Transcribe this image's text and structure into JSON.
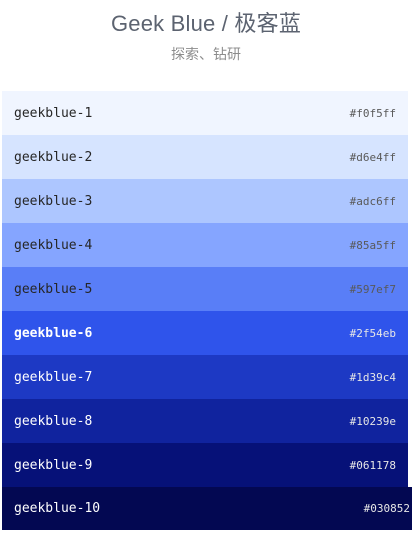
{
  "header": {
    "title": "Geek Blue / 极客蓝",
    "subtitle": "探索、钻研"
  },
  "palette": [
    {
      "name": "geekblue-1",
      "hex": "#f0f5ff",
      "color": "#f0f5ff",
      "text": "light"
    },
    {
      "name": "geekblue-2",
      "hex": "#d6e4ff",
      "color": "#d6e4ff",
      "text": "light"
    },
    {
      "name": "geekblue-3",
      "hex": "#adc6ff",
      "color": "#adc6ff",
      "text": "light"
    },
    {
      "name": "geekblue-4",
      "hex": "#85a5ff",
      "color": "#85a5ff",
      "text": "light"
    },
    {
      "name": "geekblue-5",
      "hex": "#597ef7",
      "color": "#597ef7",
      "text": "light"
    },
    {
      "name": "geekblue-6",
      "hex": "#2f54eb",
      "color": "#2f54eb",
      "text": "dark",
      "primary": true
    },
    {
      "name": "geekblue-7",
      "hex": "#1d39c4",
      "color": "#1d39c4",
      "text": "dark"
    },
    {
      "name": "geekblue-8",
      "hex": "#10239e",
      "color": "#10239e",
      "text": "dark"
    },
    {
      "name": "geekblue-9",
      "hex": "#061178",
      "color": "#061178",
      "text": "dark"
    },
    {
      "name": "geekblue-10",
      "hex": "#030852",
      "color": "#030852",
      "text": "dark"
    }
  ]
}
